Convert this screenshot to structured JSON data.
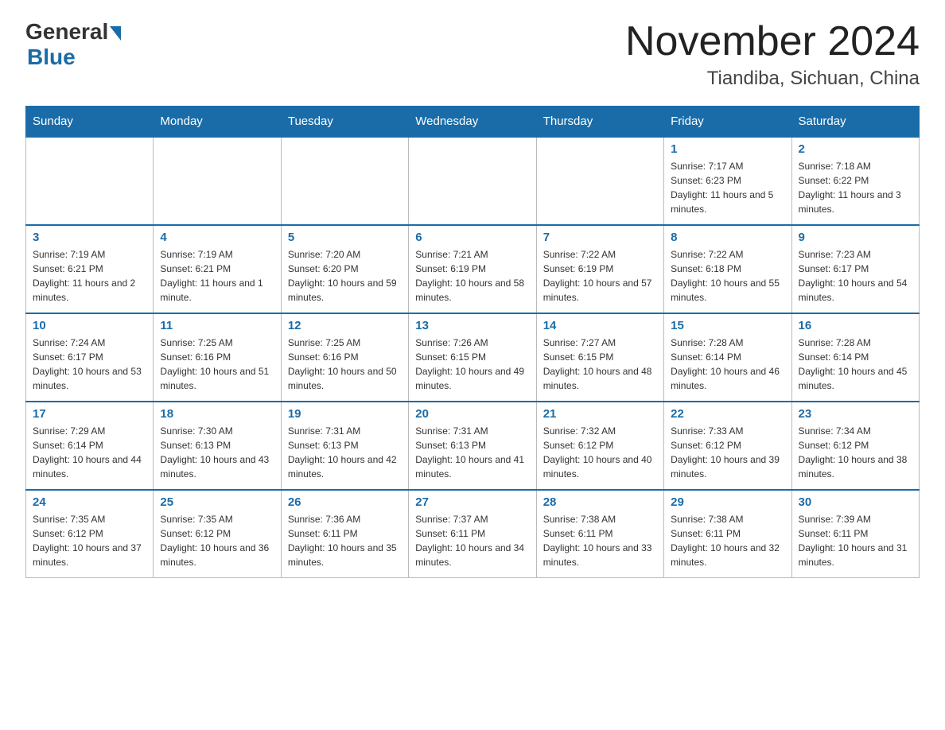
{
  "header": {
    "logo_general": "General",
    "logo_blue": "Blue",
    "month_title": "November 2024",
    "location": "Tiandiba, Sichuan, China"
  },
  "weekdays": [
    "Sunday",
    "Monday",
    "Tuesday",
    "Wednesday",
    "Thursday",
    "Friday",
    "Saturday"
  ],
  "weeks": [
    [
      {
        "day": "",
        "info": ""
      },
      {
        "day": "",
        "info": ""
      },
      {
        "day": "",
        "info": ""
      },
      {
        "day": "",
        "info": ""
      },
      {
        "day": "",
        "info": ""
      },
      {
        "day": "1",
        "info": "Sunrise: 7:17 AM\nSunset: 6:23 PM\nDaylight: 11 hours and 5 minutes."
      },
      {
        "day": "2",
        "info": "Sunrise: 7:18 AM\nSunset: 6:22 PM\nDaylight: 11 hours and 3 minutes."
      }
    ],
    [
      {
        "day": "3",
        "info": "Sunrise: 7:19 AM\nSunset: 6:21 PM\nDaylight: 11 hours and 2 minutes."
      },
      {
        "day": "4",
        "info": "Sunrise: 7:19 AM\nSunset: 6:21 PM\nDaylight: 11 hours and 1 minute."
      },
      {
        "day": "5",
        "info": "Sunrise: 7:20 AM\nSunset: 6:20 PM\nDaylight: 10 hours and 59 minutes."
      },
      {
        "day": "6",
        "info": "Sunrise: 7:21 AM\nSunset: 6:19 PM\nDaylight: 10 hours and 58 minutes."
      },
      {
        "day": "7",
        "info": "Sunrise: 7:22 AM\nSunset: 6:19 PM\nDaylight: 10 hours and 57 minutes."
      },
      {
        "day": "8",
        "info": "Sunrise: 7:22 AM\nSunset: 6:18 PM\nDaylight: 10 hours and 55 minutes."
      },
      {
        "day": "9",
        "info": "Sunrise: 7:23 AM\nSunset: 6:17 PM\nDaylight: 10 hours and 54 minutes."
      }
    ],
    [
      {
        "day": "10",
        "info": "Sunrise: 7:24 AM\nSunset: 6:17 PM\nDaylight: 10 hours and 53 minutes."
      },
      {
        "day": "11",
        "info": "Sunrise: 7:25 AM\nSunset: 6:16 PM\nDaylight: 10 hours and 51 minutes."
      },
      {
        "day": "12",
        "info": "Sunrise: 7:25 AM\nSunset: 6:16 PM\nDaylight: 10 hours and 50 minutes."
      },
      {
        "day": "13",
        "info": "Sunrise: 7:26 AM\nSunset: 6:15 PM\nDaylight: 10 hours and 49 minutes."
      },
      {
        "day": "14",
        "info": "Sunrise: 7:27 AM\nSunset: 6:15 PM\nDaylight: 10 hours and 48 minutes."
      },
      {
        "day": "15",
        "info": "Sunrise: 7:28 AM\nSunset: 6:14 PM\nDaylight: 10 hours and 46 minutes."
      },
      {
        "day": "16",
        "info": "Sunrise: 7:28 AM\nSunset: 6:14 PM\nDaylight: 10 hours and 45 minutes."
      }
    ],
    [
      {
        "day": "17",
        "info": "Sunrise: 7:29 AM\nSunset: 6:14 PM\nDaylight: 10 hours and 44 minutes."
      },
      {
        "day": "18",
        "info": "Sunrise: 7:30 AM\nSunset: 6:13 PM\nDaylight: 10 hours and 43 minutes."
      },
      {
        "day": "19",
        "info": "Sunrise: 7:31 AM\nSunset: 6:13 PM\nDaylight: 10 hours and 42 minutes."
      },
      {
        "day": "20",
        "info": "Sunrise: 7:31 AM\nSunset: 6:13 PM\nDaylight: 10 hours and 41 minutes."
      },
      {
        "day": "21",
        "info": "Sunrise: 7:32 AM\nSunset: 6:12 PM\nDaylight: 10 hours and 40 minutes."
      },
      {
        "day": "22",
        "info": "Sunrise: 7:33 AM\nSunset: 6:12 PM\nDaylight: 10 hours and 39 minutes."
      },
      {
        "day": "23",
        "info": "Sunrise: 7:34 AM\nSunset: 6:12 PM\nDaylight: 10 hours and 38 minutes."
      }
    ],
    [
      {
        "day": "24",
        "info": "Sunrise: 7:35 AM\nSunset: 6:12 PM\nDaylight: 10 hours and 37 minutes."
      },
      {
        "day": "25",
        "info": "Sunrise: 7:35 AM\nSunset: 6:12 PM\nDaylight: 10 hours and 36 minutes."
      },
      {
        "day": "26",
        "info": "Sunrise: 7:36 AM\nSunset: 6:11 PM\nDaylight: 10 hours and 35 minutes."
      },
      {
        "day": "27",
        "info": "Sunrise: 7:37 AM\nSunset: 6:11 PM\nDaylight: 10 hours and 34 minutes."
      },
      {
        "day": "28",
        "info": "Sunrise: 7:38 AM\nSunset: 6:11 PM\nDaylight: 10 hours and 33 minutes."
      },
      {
        "day": "29",
        "info": "Sunrise: 7:38 AM\nSunset: 6:11 PM\nDaylight: 10 hours and 32 minutes."
      },
      {
        "day": "30",
        "info": "Sunrise: 7:39 AM\nSunset: 6:11 PM\nDaylight: 10 hours and 31 minutes."
      }
    ]
  ]
}
